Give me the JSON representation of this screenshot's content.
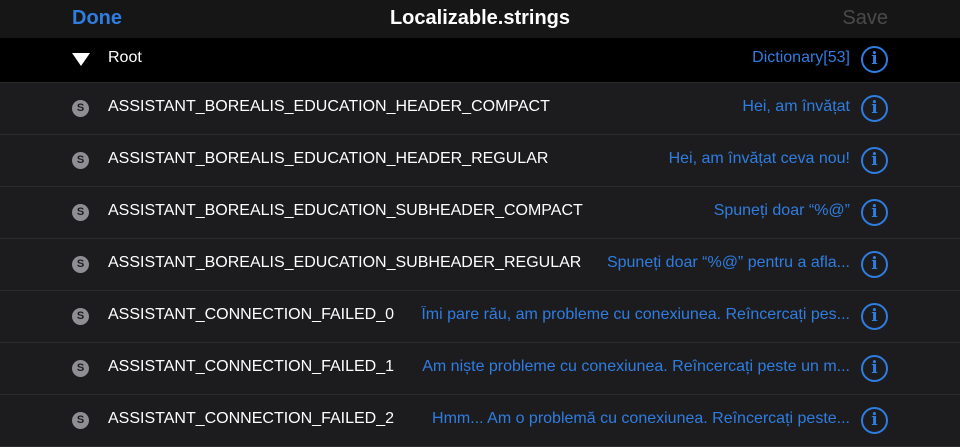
{
  "navbar": {
    "done_label": "Done",
    "title": "Localizable.strings",
    "save_label": "Save"
  },
  "root": {
    "label": "Root",
    "type": "Dictionary[53]"
  },
  "rows": [
    {
      "key": "ASSISTANT_BOREALIS_EDUCATION_HEADER_COMPACT",
      "value": "Hei, am învățat"
    },
    {
      "key": "ASSISTANT_BOREALIS_EDUCATION_HEADER_REGULAR",
      "value": "Hei, am învățat ceva nou!"
    },
    {
      "key": "ASSISTANT_BOREALIS_EDUCATION_SUBHEADER_COMPACT",
      "value": "Spuneți doar “%@”"
    },
    {
      "key": "ASSISTANT_BOREALIS_EDUCATION_SUBHEADER_REGULAR",
      "value": "Spuneți doar “%@” pentru a afla..."
    },
    {
      "key": "ASSISTANT_CONNECTION_FAILED_0",
      "value": "Îmi pare rău, am probleme cu conexiunea. Reîncercați pes..."
    },
    {
      "key": "ASSISTANT_CONNECTION_FAILED_1",
      "value": "Am niște probleme cu conexiunea. Reîncercați peste un m..."
    },
    {
      "key": "ASSISTANT_CONNECTION_FAILED_2",
      "value": "Hmm... Am o problemă cu conexiunea. Reîncercați peste..."
    }
  ],
  "type_badge": "S",
  "info_glyph": "i",
  "colors": {
    "accent": "#2f7de1",
    "background": "#000000",
    "row_background": "#1c1c1e",
    "disabled": "#4a4a4a"
  }
}
